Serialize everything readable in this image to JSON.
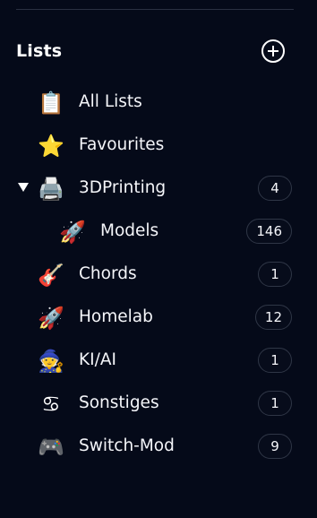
{
  "header": {
    "title": "Lists",
    "add_icon": "plus-circle-icon"
  },
  "colors": {
    "background": "#050a19",
    "text": "#ffffff",
    "badge_border": "#2f3646"
  },
  "lists": [
    {
      "name": "all-lists",
      "label": "All Lists",
      "icon": "📋",
      "icon_name": "clipboard-icon",
      "count": "",
      "indent": false,
      "expanded": null
    },
    {
      "name": "favourites",
      "label": "Favourites",
      "icon": "⭐",
      "icon_name": "star-icon",
      "count": "",
      "indent": false,
      "expanded": null
    },
    {
      "name": "3dprinting",
      "label": "3DPrinting",
      "icon": "🖨️",
      "icon_name": "printer-icon",
      "count": "4",
      "indent": false,
      "expanded": true
    },
    {
      "name": "models",
      "label": "Models",
      "icon": "🚀",
      "icon_name": "rocket-icon",
      "count": "146",
      "indent": true,
      "expanded": null
    },
    {
      "name": "chords",
      "label": "Chords",
      "icon": "🎸",
      "icon_name": "guitar-icon",
      "count": "1",
      "indent": false,
      "expanded": null
    },
    {
      "name": "homelab",
      "label": "Homelab",
      "icon": "🚀",
      "icon_name": "rocket-icon",
      "count": "12",
      "indent": false,
      "expanded": null
    },
    {
      "name": "ki-ai",
      "label": "KI/AI",
      "icon": "🧙",
      "icon_name": "wizard-face-icon",
      "count": "1",
      "indent": false,
      "expanded": null
    },
    {
      "name": "sonstiges",
      "label": "Sonstiges",
      "icon": "♋",
      "icon_name": "cancer-zodiac-icon",
      "count": "1",
      "indent": false,
      "expanded": null
    },
    {
      "name": "switch-mod",
      "label": "Switch-Mod",
      "icon": "🎮",
      "icon_name": "game-controller-icon",
      "count": "9",
      "indent": false,
      "expanded": null
    }
  ]
}
